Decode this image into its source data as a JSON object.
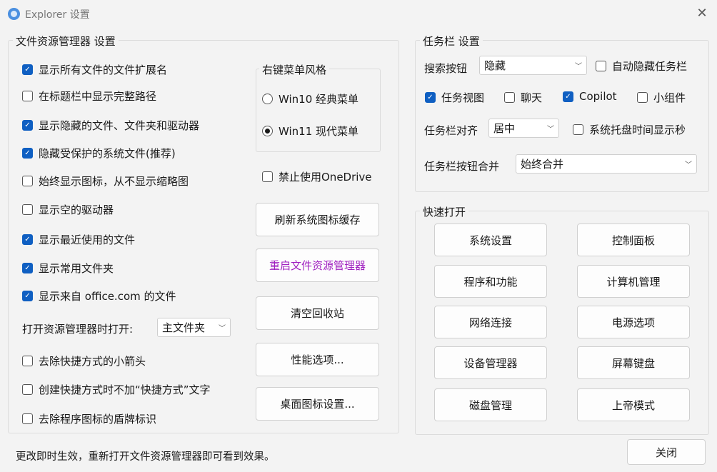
{
  "window": {
    "title": "Explorer 设置",
    "close": "✕"
  },
  "explorer": {
    "title": "文件资源管理器 设置",
    "checks": [
      {
        "label": "显示所有文件的文件扩展名",
        "checked": true
      },
      {
        "label": "在标题栏中显示完整路径",
        "checked": false
      },
      {
        "label": "显示隐藏的文件、文件夹和驱动器",
        "checked": true
      },
      {
        "label": "隐藏受保护的系统文件(推荐)",
        "checked": true
      },
      {
        "label": "始终显示图标，从不显示缩略图",
        "checked": false
      },
      {
        "label": "显示空的驱动器",
        "checked": false
      },
      {
        "label": "显示最近使用的文件",
        "checked": true
      },
      {
        "label": "显示常用文件夹",
        "checked": true
      },
      {
        "label": "显示来自 office.com 的文件",
        "checked": true
      }
    ],
    "open_label": "打开资源管理器时打开:",
    "open_value": "主文件夹",
    "checks2": [
      {
        "label": "去除快捷方式的小箭头",
        "checked": false
      },
      {
        "label": "创建快捷方式时不加“快捷方式”文字",
        "checked": false
      },
      {
        "label": "去除程序图标的盾牌标识",
        "checked": false
      }
    ],
    "menu_style": {
      "title": "右键菜单风格",
      "options": [
        "Win10 经典菜单",
        "Win11 现代菜单"
      ],
      "selected": 1
    },
    "onedrive": {
      "label": "禁止使用OneDrive",
      "checked": false
    },
    "buttons": [
      "刷新系统图标缓存",
      "重启文件资源管理器",
      "清空回收站",
      "性能选项...",
      "桌面图标设置..."
    ]
  },
  "taskbar": {
    "title": "任务栏 设置",
    "search_label": "搜索按钮",
    "search_value": "隐藏",
    "autohide": {
      "label": "自动隐藏任务栏",
      "checked": false
    },
    "taskview": {
      "label": "任务视图",
      "checked": true
    },
    "chat": {
      "label": "聊天",
      "checked": false
    },
    "copilot": {
      "label": "Copilot",
      "checked": true
    },
    "widgets": {
      "label": "小组件",
      "checked": false
    },
    "align_label": "任务栏对齐",
    "align_value": "居中",
    "seconds": {
      "label": "系统托盘时间显示秒",
      "checked": false
    },
    "combine_label": "任务栏按钮合并",
    "combine_value": "始终合并"
  },
  "quick": {
    "title": "快速打开",
    "buttons": [
      "系统设置",
      "控制面板",
      "程序和功能",
      "计算机管理",
      "网络连接",
      "电源选项",
      "设备管理器",
      "屏幕键盘",
      "磁盘管理",
      "上帝模式"
    ]
  },
  "footer": {
    "note": "更改即时生效，重新打开文件资源管理器即可看到效果。",
    "close": "关闭"
  },
  "colors": {
    "accent": "#0f5fc2",
    "restart": "#a020c0"
  }
}
